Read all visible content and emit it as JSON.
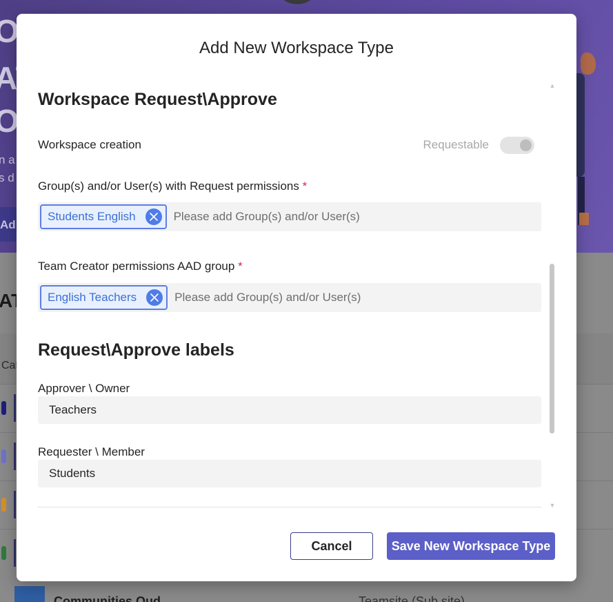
{
  "background": {
    "hero_lines": [
      "O",
      "AT",
      "ON"
    ],
    "hero_small_lines": [
      "n a",
      "s d"
    ],
    "hero_button_label": "Ad",
    "section_title": "AT",
    "table_column": "Cat",
    "row_colors": [
      "#1f1f7a",
      "#6f73c8",
      "#d4902a",
      "#2f7a3d"
    ],
    "last_row_name": "Communities Oud",
    "last_row_type": "Teamsite (Sub site)"
  },
  "modal": {
    "title": "Add New Workspace Type",
    "section_request_approve": {
      "heading": "Workspace Request\\Approve",
      "workspace_creation_label": "Workspace creation",
      "toggle_label": "Requestable",
      "request_permissions_label": "Group(s) and/or User(s) with Request permissions",
      "required_marker": "*",
      "request_permissions_chip": "Students English",
      "request_permissions_placeholder": "Please add Group(s) and/or User(s)",
      "team_creator_label": "Team Creator permissions AAD group",
      "team_creator_chip": "English Teachers",
      "team_creator_placeholder": "Please add Group(s) and/or User(s)"
    },
    "section_labels": {
      "heading": "Request\\Approve labels",
      "approver_label": "Approver \\ Owner",
      "approver_value": "Teachers",
      "requester_label": "Requester \\ Member",
      "requester_value": "Students"
    },
    "buttons": {
      "cancel": "Cancel",
      "save": "Save New Workspace Type"
    }
  },
  "colors": {
    "accent": "#5b5fc7",
    "chip_border": "#5b7ee6",
    "chip_text": "#3d6fd6",
    "required": "#c4314b"
  }
}
